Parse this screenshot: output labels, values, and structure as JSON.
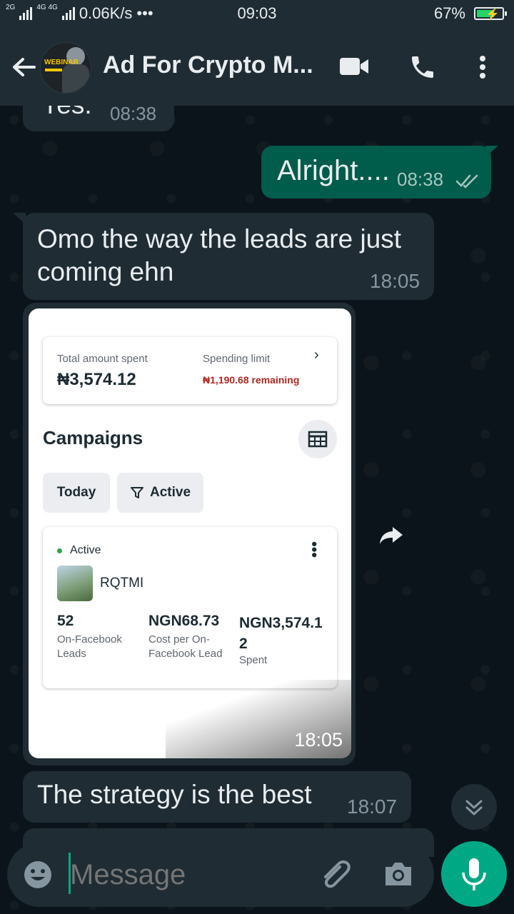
{
  "status_bar": {
    "network_left": "2G",
    "network_mid": "4G 4G",
    "speed": "0.06K/s",
    "dots": "•••",
    "time": "09:03",
    "battery": "67%"
  },
  "header": {
    "avatar_text": "WEBINAR",
    "title": "Ad For Crypto M..."
  },
  "messages": {
    "m1": {
      "text": "Yes.",
      "time": "08:38"
    },
    "m2": {
      "text": "Alright....",
      "time": "08:38"
    },
    "m3": {
      "text": "Omo the way the leads are just coming ehn",
      "time": "18:05"
    },
    "m4_time": "18:05",
    "m5": {
      "text": "The strategy is the best",
      "time": "18:07"
    }
  },
  "ad_card": {
    "total_label": "Total amount spent",
    "total_value": "₦3,574.12",
    "limit_label": "Spending limit",
    "limit_value": "₦1,190.68 remaining",
    "campaigns_title": "Campaigns",
    "filter_today": "Today",
    "filter_active": "Active",
    "status": "Active",
    "campaign_name": "RQTMI",
    "metrics": [
      {
        "value": "52",
        "label": "On-Facebook Leads"
      },
      {
        "value": "NGN68.73",
        "label": "Cost per On-Facebook Lead"
      },
      {
        "value": "NGN3,574.12",
        "label": "Spent"
      }
    ]
  },
  "composer": {
    "placeholder": "Message"
  },
  "colors": {
    "accent": "#00a884",
    "out_bubble": "#005c4b",
    "in_bubble": "#1f2c34",
    "limit_red": "#b3261e"
  }
}
